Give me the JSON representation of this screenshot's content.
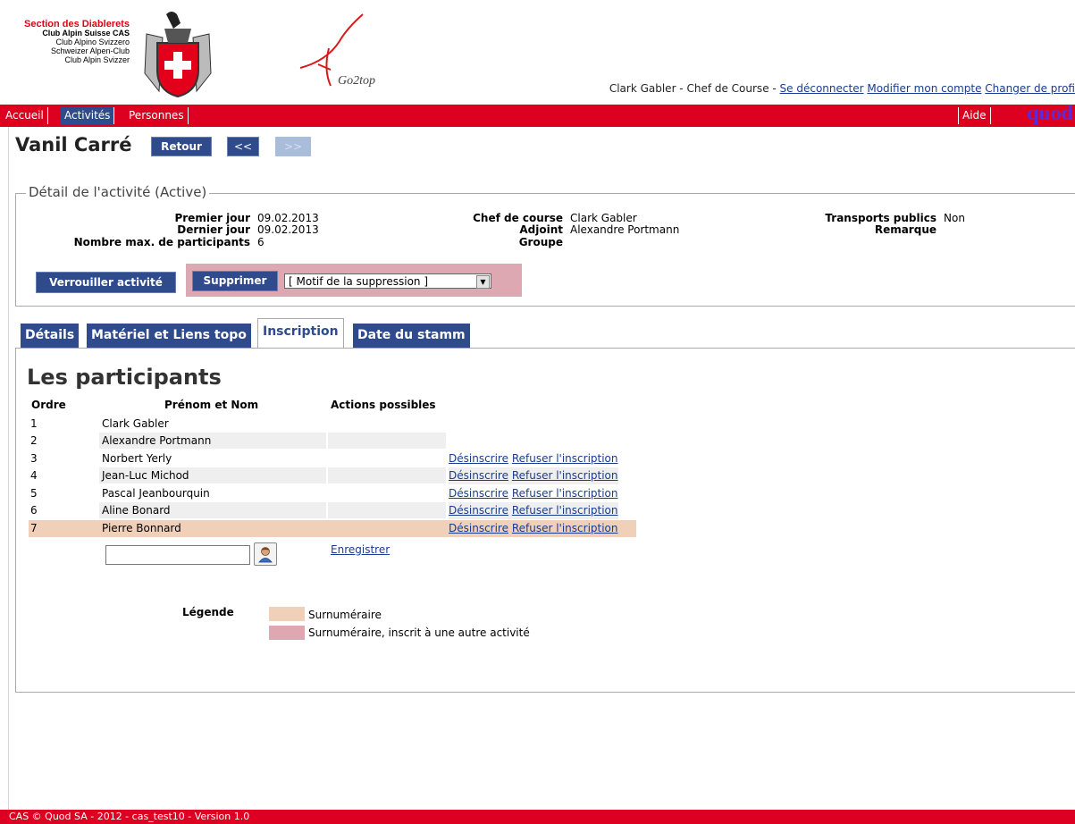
{
  "header": {
    "section_name": "Section des Diablerets",
    "club_lines": [
      "Club Alpin Suisse CAS",
      "Club Alpino Svizzero",
      "Schweizer Alpen-Club",
      "Club Alpin Svizzer"
    ],
    "user_text": "Clark Gabler - Chef de Course -",
    "logout_link": "Se déconnecter",
    "account_link": "Modifier mon compte",
    "profile_link": "Changer de profi",
    "go2top_logo": "Go2top",
    "quod_logo": "quod"
  },
  "nav": {
    "items": [
      "Accueil",
      "Activités",
      "Personnes"
    ],
    "active": "Activités",
    "help": "Aide"
  },
  "page": {
    "title": "Vanil Carré",
    "back_button": "Retour",
    "prev_button": "<<",
    "next_button": ">>"
  },
  "detail": {
    "legend": "Détail de l'activité  (Active)",
    "first_day_label": "Premier jour",
    "first_day": "09.02.2013",
    "last_day_label": "Dernier jour",
    "last_day": "09.02.2013",
    "max_label": "Nombre max. de participants",
    "max": "6",
    "chef_label": "Chef de course",
    "chef": "Clark Gabler",
    "adjoint_label": "Adjoint",
    "adjoint": "Alexandre Portmann",
    "groupe_label": "Groupe",
    "groupe": "",
    "transport_label": "Transports publics",
    "transport": "Non",
    "remarque_label": "Remarque",
    "remarque": "",
    "lock_button": "Verrouiller activité",
    "delete_button": "Supprimer",
    "delete_reason_selected": "[ Motif de la suppression ]"
  },
  "tabs": [
    "Détails",
    "Matériel et Liens topo",
    "Inscription",
    "Date du stamm"
  ],
  "active_tab": "Inscription",
  "participants": {
    "title": "Les participants",
    "columns": [
      "Ordre",
      "Prénom et Nom",
      "Actions possibles"
    ],
    "rows": [
      {
        "order": "1",
        "name": "Clark Gabler",
        "unsubscribe": "",
        "refuse": ""
      },
      {
        "order": "2",
        "name": "Alexandre Portmann",
        "unsubscribe": "",
        "refuse": ""
      },
      {
        "order": "3",
        "name": "Norbert Yerly",
        "unsubscribe": "Désinscrire",
        "refuse": "Refuser l'inscription"
      },
      {
        "order": "4",
        "name": "Jean-Luc Michod",
        "unsubscribe": "Désinscrire",
        "refuse": "Refuser l'inscription"
      },
      {
        "order": "5",
        "name": "Pascal Jeanbourquin",
        "unsubscribe": "Désinscrire",
        "refuse": "Refuser l'inscription"
      },
      {
        "order": "6",
        "name": "Aline Bonard",
        "unsubscribe": "Désinscrire",
        "refuse": "Refuser l'inscription"
      },
      {
        "order": "7",
        "name": "Pierre Bonnard",
        "unsubscribe": "Désinscrire",
        "refuse": "Refuser l'inscription"
      }
    ],
    "save_link": "Enregistrer",
    "add_input_value": ""
  },
  "legend": {
    "label": "Légende",
    "items": [
      {
        "text": "Surnuméraire",
        "color": "#f0d0b8"
      },
      {
        "text": "Surnuméraire, inscrit à une autre activité",
        "color": "#dda8b2"
      }
    ]
  },
  "footer": {
    "text": "CAS © Quod SA - 2012 - cas_test10 - Version 1.0"
  },
  "colors": {
    "brand_red": "#dd0021",
    "nav_blue": "#2f4b8b"
  }
}
